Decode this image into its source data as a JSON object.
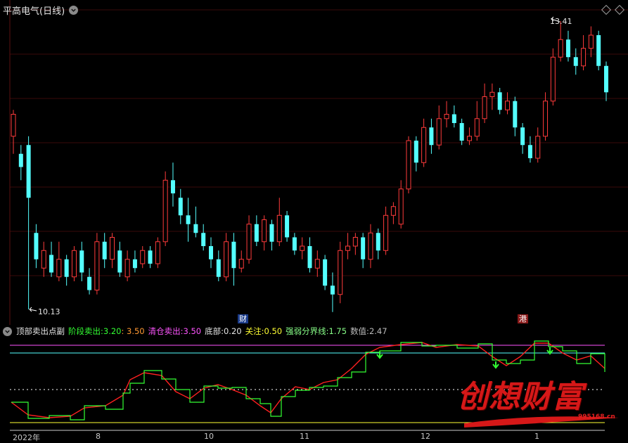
{
  "title": "平高电气(日线)",
  "price_high_label": "13.41",
  "price_low_label": "10.13",
  "markers": {
    "cai": "财",
    "gang": "港"
  },
  "indicator": {
    "name": "顶部卖出点副",
    "stage_sell_label": "阶段卖出:",
    "stage_sell_value": "3.20",
    "stage_sell_value2": ": 3.50",
    "clear_sell_label": "清仓卖出:",
    "clear_sell_value": "3.50",
    "bottom_label": "底部:",
    "bottom_value": "0.20",
    "focus_label": "关注:",
    "focus_value": "0.50",
    "divide_label": "强弱分界线:",
    "divide_value": "1.75",
    "num_label": "数值:",
    "num_value": "2.47"
  },
  "x_labels": {
    "year": "2022年",
    "m8": "8",
    "m10": "10",
    "m11": "11",
    "m12": "12",
    "m1": "1"
  },
  "watermark": {
    "text": "创想财富",
    "url": "995168.cn"
  },
  "colors": {
    "up": "#ff3b3b",
    "down": "#54ffff",
    "grid": "#3a0a0a",
    "indicator_line": "#ff2020",
    "indicator_step": "#33ff33"
  },
  "chart_data": {
    "type": "candlestick",
    "title": "平高电气(日线)",
    "ylim": [
      10.13,
      13.41
    ],
    "annotations": [
      "13.41",
      "10.13"
    ],
    "candles": [
      {
        "o": 12.1,
        "c": 12.35,
        "h": 12.4,
        "l": 11.9
      },
      {
        "o": 11.9,
        "c": 11.75,
        "h": 12.0,
        "l": 11.6
      },
      {
        "o": 12.0,
        "c": 11.4,
        "h": 12.1,
        "l": 10.13
      },
      {
        "o": 11.0,
        "c": 10.7,
        "h": 11.1,
        "l": 10.6
      },
      {
        "o": 10.6,
        "c": 10.8,
        "h": 10.9,
        "l": 10.5
      },
      {
        "o": 10.75,
        "c": 10.55,
        "h": 10.9,
        "l": 10.5
      },
      {
        "o": 10.5,
        "c": 10.7,
        "h": 10.9,
        "l": 10.45
      },
      {
        "o": 10.7,
        "c": 10.5,
        "h": 10.75,
        "l": 10.4
      },
      {
        "o": 10.5,
        "c": 10.8,
        "h": 10.85,
        "l": 10.45
      },
      {
        "o": 10.8,
        "c": 10.55,
        "h": 10.9,
        "l": 10.45
      },
      {
        "o": 10.5,
        "c": 10.35,
        "h": 10.6,
        "l": 10.3
      },
      {
        "o": 10.35,
        "c": 10.9,
        "h": 11.0,
        "l": 10.3
      },
      {
        "o": 10.9,
        "c": 10.7,
        "h": 11.0,
        "l": 10.6
      },
      {
        "o": 10.7,
        "c": 10.95,
        "h": 11.0,
        "l": 10.6
      },
      {
        "o": 10.8,
        "c": 10.55,
        "h": 10.9,
        "l": 10.5
      },
      {
        "o": 10.5,
        "c": 10.7,
        "h": 10.8,
        "l": 10.45
      },
      {
        "o": 10.7,
        "c": 10.6,
        "h": 10.8,
        "l": 10.55
      },
      {
        "o": 10.65,
        "c": 10.8,
        "h": 10.85,
        "l": 10.6
      },
      {
        "o": 10.8,
        "c": 10.65,
        "h": 10.85,
        "l": 10.6
      },
      {
        "o": 10.65,
        "c": 10.9,
        "h": 10.95,
        "l": 10.6
      },
      {
        "o": 10.9,
        "c": 11.6,
        "h": 11.7,
        "l": 10.85
      },
      {
        "o": 11.6,
        "c": 11.45,
        "h": 11.8,
        "l": 11.3
      },
      {
        "o": 11.4,
        "c": 11.2,
        "h": 11.5,
        "l": 11.1
      },
      {
        "o": 11.2,
        "c": 11.1,
        "h": 11.4,
        "l": 10.9
      },
      {
        "o": 11.1,
        "c": 11.0,
        "h": 11.3,
        "l": 10.95
      },
      {
        "o": 11.0,
        "c": 10.85,
        "h": 11.1,
        "l": 10.8
      },
      {
        "o": 10.85,
        "c": 10.7,
        "h": 10.95,
        "l": 10.6
      },
      {
        "o": 10.7,
        "c": 10.5,
        "h": 10.8,
        "l": 10.45
      },
      {
        "o": 10.5,
        "c": 10.9,
        "h": 11.0,
        "l": 10.45
      },
      {
        "o": 10.9,
        "c": 10.6,
        "h": 11.0,
        "l": 10.4
      },
      {
        "o": 10.6,
        "c": 10.7,
        "h": 10.8,
        "l": 10.55
      },
      {
        "o": 10.7,
        "c": 11.1,
        "h": 11.2,
        "l": 10.65
      },
      {
        "o": 11.1,
        "c": 10.9,
        "h": 11.2,
        "l": 10.85
      },
      {
        "o": 10.9,
        "c": 11.15,
        "h": 11.2,
        "l": 10.8
      },
      {
        "o": 11.1,
        "c": 10.9,
        "h": 11.15,
        "l": 10.8
      },
      {
        "o": 10.9,
        "c": 11.2,
        "h": 11.4,
        "l": 10.85
      },
      {
        "o": 11.2,
        "c": 10.95,
        "h": 11.25,
        "l": 10.9
      },
      {
        "o": 10.95,
        "c": 10.8,
        "h": 11.0,
        "l": 10.75
      },
      {
        "o": 10.8,
        "c": 10.85,
        "h": 10.95,
        "l": 10.7
      },
      {
        "o": 10.85,
        "c": 10.6,
        "h": 10.95,
        "l": 10.55
      },
      {
        "o": 10.6,
        "c": 10.7,
        "h": 10.8,
        "l": 10.5
      },
      {
        "o": 10.7,
        "c": 10.4,
        "h": 10.75,
        "l": 10.35
      },
      {
        "o": 10.4,
        "c": 10.3,
        "h": 10.55,
        "l": 10.1
      },
      {
        "o": 10.3,
        "c": 10.8,
        "h": 10.9,
        "l": 10.2
      },
      {
        "o": 10.8,
        "c": 10.85,
        "h": 11.0,
        "l": 10.7
      },
      {
        "o": 10.85,
        "c": 10.95,
        "h": 11.0,
        "l": 10.75
      },
      {
        "o": 10.95,
        "c": 10.7,
        "h": 11.0,
        "l": 10.6
      },
      {
        "o": 10.7,
        "c": 11.0,
        "h": 11.1,
        "l": 10.6
      },
      {
        "o": 11.0,
        "c": 10.8,
        "h": 11.05,
        "l": 10.7
      },
      {
        "o": 10.8,
        "c": 11.2,
        "h": 11.3,
        "l": 10.75
      },
      {
        "o": 11.2,
        "c": 11.3,
        "h": 11.35,
        "l": 11.1
      },
      {
        "o": 11.1,
        "c": 11.5,
        "h": 11.6,
        "l": 11.05
      },
      {
        "o": 11.5,
        "c": 12.05,
        "h": 12.1,
        "l": 11.45
      },
      {
        "o": 12.05,
        "c": 11.8,
        "h": 12.1,
        "l": 11.7
      },
      {
        "o": 11.8,
        "c": 12.2,
        "h": 12.3,
        "l": 11.75
      },
      {
        "o": 12.2,
        "c": 12.0,
        "h": 12.3,
        "l": 11.9
      },
      {
        "o": 12.0,
        "c": 12.3,
        "h": 12.45,
        "l": 11.95
      },
      {
        "o": 12.3,
        "c": 12.35,
        "h": 12.5,
        "l": 12.2
      },
      {
        "o": 12.35,
        "c": 12.25,
        "h": 12.45,
        "l": 12.2
      },
      {
        "o": 12.25,
        "c": 12.05,
        "h": 12.3,
        "l": 12.0
      },
      {
        "o": 12.05,
        "c": 12.1,
        "h": 12.2,
        "l": 12.0
      },
      {
        "o": 12.1,
        "c": 12.3,
        "h": 12.5,
        "l": 12.05
      },
      {
        "o": 12.3,
        "c": 12.55,
        "h": 12.7,
        "l": 12.25
      },
      {
        "o": 12.55,
        "c": 12.6,
        "h": 12.7,
        "l": 12.4
      },
      {
        "o": 12.6,
        "c": 12.4,
        "h": 12.65,
        "l": 12.35
      },
      {
        "o": 12.4,
        "c": 12.5,
        "h": 12.6,
        "l": 12.35
      },
      {
        "o": 12.5,
        "c": 12.2,
        "h": 12.55,
        "l": 12.1
      },
      {
        "o": 12.2,
        "c": 12.0,
        "h": 12.25,
        "l": 11.9
      },
      {
        "o": 12.0,
        "c": 11.85,
        "h": 12.1,
        "l": 11.8
      },
      {
        "o": 11.85,
        "c": 12.1,
        "h": 12.2,
        "l": 11.8
      },
      {
        "o": 12.1,
        "c": 12.5,
        "h": 12.6,
        "l": 12.05
      },
      {
        "o": 12.5,
        "c": 13.0,
        "h": 13.1,
        "l": 12.45
      },
      {
        "o": 13.0,
        "c": 13.2,
        "h": 13.41,
        "l": 12.95
      },
      {
        "o": 13.2,
        "c": 13.0,
        "h": 13.3,
        "l": 12.95
      },
      {
        "o": 13.0,
        "c": 12.9,
        "h": 13.1,
        "l": 12.8
      },
      {
        "o": 12.9,
        "c": 13.1,
        "h": 13.25,
        "l": 12.85
      },
      {
        "o": 13.1,
        "c": 13.25,
        "h": 13.35,
        "l": 13.0
      },
      {
        "o": 13.25,
        "c": 12.9,
        "h": 13.3,
        "l": 12.85
      },
      {
        "o": 12.9,
        "c": 12.6,
        "h": 12.95,
        "l": 12.5
      }
    ]
  }
}
